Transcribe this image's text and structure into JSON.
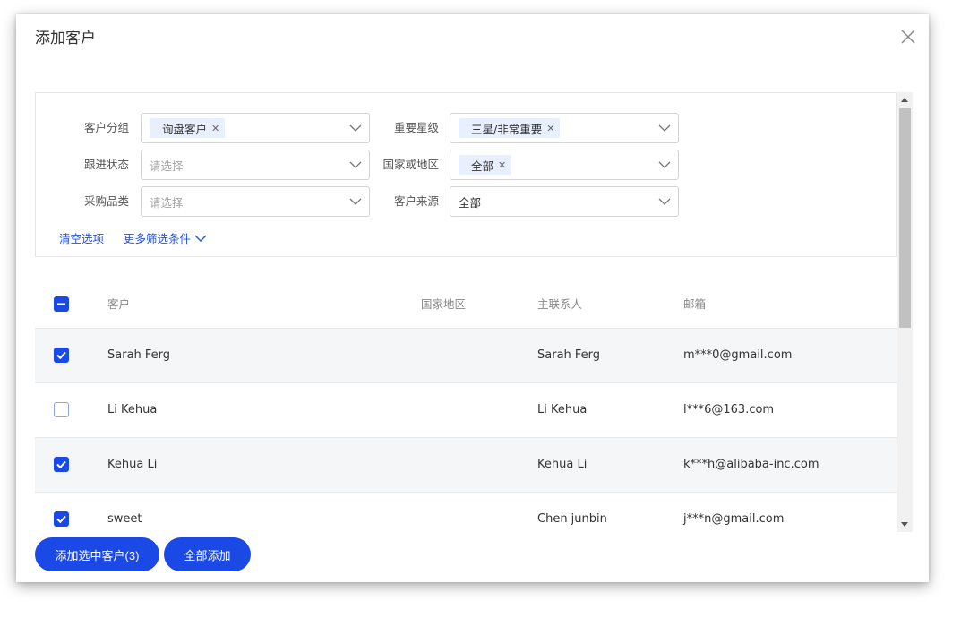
{
  "dialog": {
    "title": "添加客户"
  },
  "filters": {
    "customer_group": {
      "label": "客户分组",
      "tags": [
        "询盘客户"
      ]
    },
    "importance": {
      "label": "重要星级",
      "tags": [
        "三星/非常重要"
      ]
    },
    "follow_status": {
      "label": "跟进状态",
      "placeholder": "请选择"
    },
    "country": {
      "label": "国家或地区",
      "tags": [
        "全部"
      ]
    },
    "category": {
      "label": "采购品类",
      "placeholder": "请选择"
    },
    "source": {
      "label": "客户来源",
      "value": "全部"
    },
    "clear_label": "清空选项",
    "more_label": "更多筛选条件"
  },
  "table": {
    "columns": [
      "客户",
      "国家地区",
      "主联系人",
      "邮箱"
    ],
    "rows": [
      {
        "checked": true,
        "customer": "Sarah Ferg",
        "country": "",
        "contact": "Sarah Ferg",
        "email": "m***0@gmail.com"
      },
      {
        "checked": false,
        "customer": "Li Kehua",
        "country": "",
        "contact": "Li Kehua",
        "email": "l***6@163.com"
      },
      {
        "checked": true,
        "customer": "Kehua Li",
        "country": "",
        "contact": "Kehua Li",
        "email": "k***h@alibaba-inc.com"
      },
      {
        "checked": true,
        "customer": "sweet",
        "country": "",
        "contact": "Chen junbin",
        "email": "j***n@gmail.com"
      }
    ]
  },
  "actions": {
    "add_selected_label": "添加选中客户(3)",
    "add_all_label": "全部添加"
  },
  "colors": {
    "primary": "#1a49e6",
    "link": "#2152e3",
    "tag_bg": "#e8efff"
  }
}
